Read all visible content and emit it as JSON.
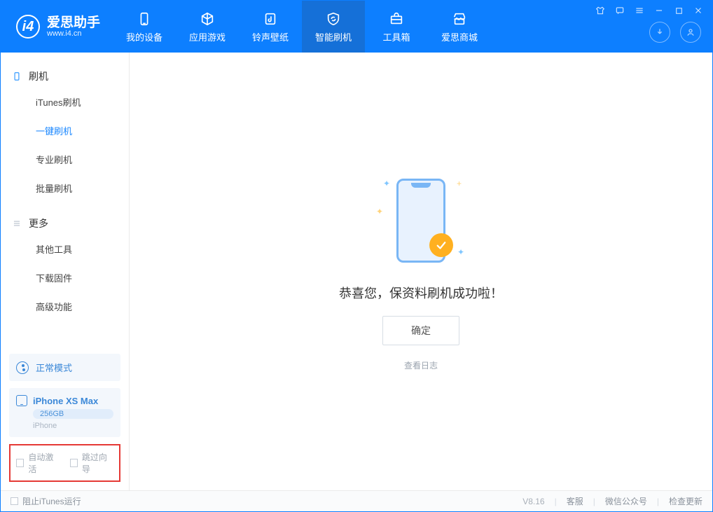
{
  "app": {
    "name_cn": "爱思助手",
    "name_en": "www.i4.cn"
  },
  "nav": {
    "tabs": [
      {
        "label": "我的设备"
      },
      {
        "label": "应用游戏"
      },
      {
        "label": "铃声壁纸"
      },
      {
        "label": "智能刷机"
      },
      {
        "label": "工具箱"
      },
      {
        "label": "爱思商城"
      }
    ]
  },
  "sidebar": {
    "groups": [
      {
        "title": "刷机",
        "items": [
          "iTunes刷机",
          "一键刷机",
          "专业刷机",
          "批量刷机"
        ]
      },
      {
        "title": "更多",
        "items": [
          "其他工具",
          "下载固件",
          "高级功能"
        ]
      }
    ],
    "mode_label": "正常模式",
    "device": {
      "name": "iPhone XS Max",
      "capacity": "256GB",
      "type": "iPhone"
    },
    "checks": {
      "auto_activate": "自动激活",
      "skip_guide": "跳过向导"
    }
  },
  "main": {
    "success_title": "恭喜您，保资料刷机成功啦！",
    "confirm_label": "确定",
    "view_log": "查看日志"
  },
  "footer": {
    "block_itunes": "阻止iTunes运行",
    "version": "V8.16",
    "links": [
      "客服",
      "微信公众号",
      "检查更新"
    ]
  }
}
